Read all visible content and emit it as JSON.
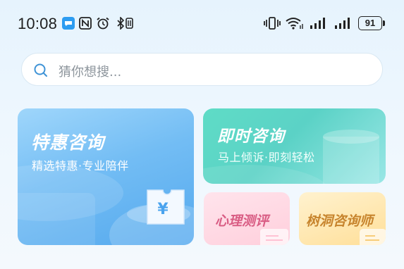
{
  "status_bar": {
    "time": "10:08",
    "left_icons": [
      "chat-app-icon",
      "nfc-icon",
      "alarm-icon",
      "bluetooth-icon"
    ],
    "right_icons": [
      "vibrate-icon",
      "wifi-icon",
      "signal-icon",
      "signal-icon"
    ],
    "battery": "91"
  },
  "search": {
    "placeholder": "猜你想搜..."
  },
  "cards": {
    "special": {
      "title": "特惠咨询",
      "subtitle": "精选特惠·专业陪伴",
      "icon": "yuan-coupon-icon"
    },
    "instant": {
      "title": "即时咨询",
      "subtitle": "马上倾诉·即刻轻松"
    },
    "psych_test": {
      "title": "心理测评"
    },
    "treehole": {
      "title": "树洞咨询师"
    }
  },
  "colors": {
    "special_card": "#73bdf4",
    "instant_card": "#5bd2c6",
    "psych_card": "#ffd3df",
    "treehole_card": "#ffe4a8"
  }
}
